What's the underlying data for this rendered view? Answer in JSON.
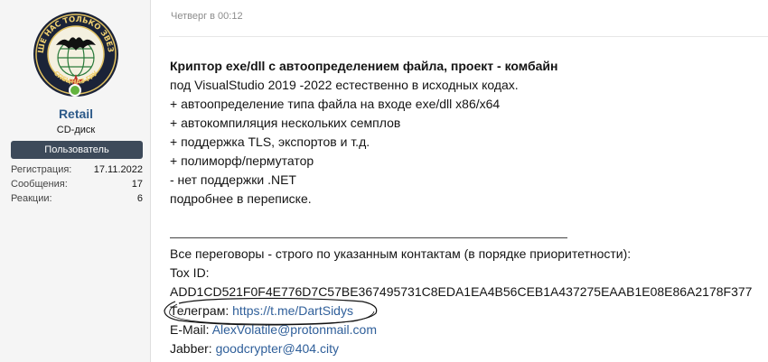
{
  "user": {
    "avatar_text_top": "ВЫШЕ НАС ТОЛЬКО ЗВЕЗДЫ",
    "avatar_text_bottom": "СПЕЦНАЗ ГРУ",
    "username": "Retail",
    "title": "CD-диск",
    "banner": "Пользователь",
    "stats": [
      {
        "label": "Регистрация:",
        "value": "17.11.2022"
      },
      {
        "label": "Сообщения:",
        "value": "17"
      },
      {
        "label": "Реакции:",
        "value": "6"
      }
    ],
    "online_icon": "online-indicator-icon"
  },
  "post": {
    "time": "Четверг в 00:12",
    "title": "Криптор exe/dll с автоопределением файла, проект - комбайн",
    "lines": [
      "под VisualStudio 2019 -2022 естественно в исходных кодах.",
      "+ автоопределение типа файла на входе exe/dll x86/x64",
      "+ автокомпиляция нескольких семплов",
      "+ поддержка TLS, экспортов и т.д.",
      "+ полиморф/пермутатор",
      "- нет поддержки .NET",
      "подробнее в переписке."
    ],
    "contacts": {
      "intro": "Все переговоры - строго по указанным контактам (в порядке приоритетности):",
      "tox_label": "Tox ID:",
      "tox_id": "ADD1CD521F0F4E776D7C57BE367495731C8EDA1EA4B56CEB1A437275EAAB1E08E86A2178F377",
      "telegram_label": "Телеграм:",
      "telegram_link": "https://t.me/DartSidys",
      "email_label": "E-Mail:",
      "email_link": "AlexVolatile@protonmail.com",
      "jabber_label": "Jabber:",
      "jabber_link": "goodcrypter@404.city"
    }
  },
  "colors": {
    "link": "#2f5f9a",
    "username": "#2e5b8a",
    "banner_bg": "#3d4a5a",
    "online": "#63b33f"
  }
}
